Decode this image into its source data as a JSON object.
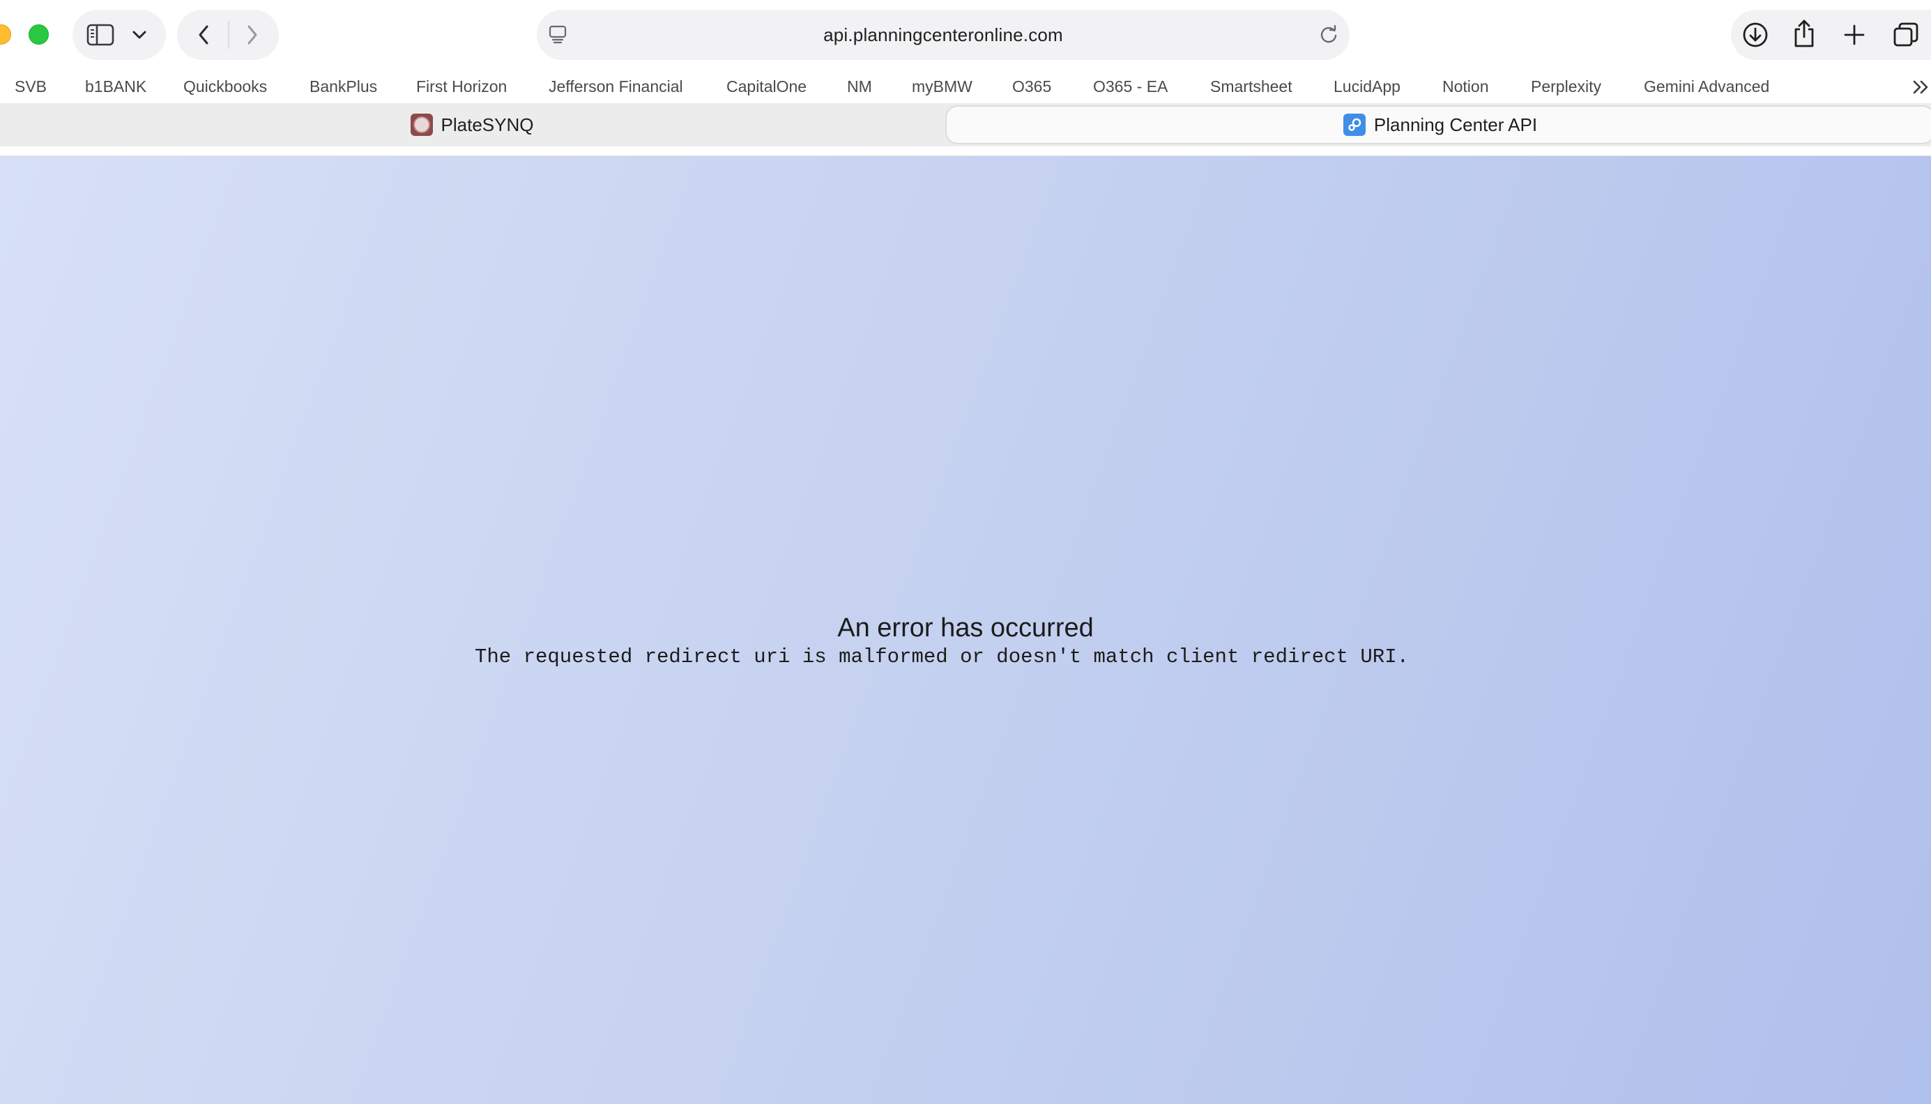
{
  "browser": {
    "address_bar": {
      "url": "api.planningcenteronline.com"
    },
    "icons": {
      "sidebar": "sidebar-toggle-icon",
      "tab_group_menu": "chevron-down-icon",
      "back": "chevron-left-icon",
      "forward": "chevron-right-icon",
      "page_menu": "page-menu-icon",
      "reload": "reload-icon",
      "downloads": "download-icon",
      "share": "share-icon",
      "new_tab": "plus-icon",
      "tab_overview": "tab-overview-icon",
      "more_favorites": "double-chevron-icon"
    },
    "favorites": [
      "SVB",
      "b1BANK",
      "Quickbooks",
      "BankPlus",
      "First Horizon",
      "Jefferson Financial",
      "CapitalOne",
      "NM",
      "myBMW",
      "O365",
      "O365 - EA",
      "Smartsheet",
      "LucidApp",
      "Notion",
      "Perplexity",
      "Gemini Advanced"
    ],
    "tabs": [
      {
        "label": "PlateSYNQ",
        "active": false
      },
      {
        "label": "Planning Center API",
        "active": true
      }
    ]
  },
  "page": {
    "error_title": "An error has occurred",
    "error_message": "The requested redirect uri is malformed or doesn't match client redirect URI."
  },
  "colors": {
    "background_start": "#d7e0f6",
    "background_end": "#b0c0ec",
    "traffic_yellow": "#febc2e",
    "traffic_green": "#28c840"
  }
}
